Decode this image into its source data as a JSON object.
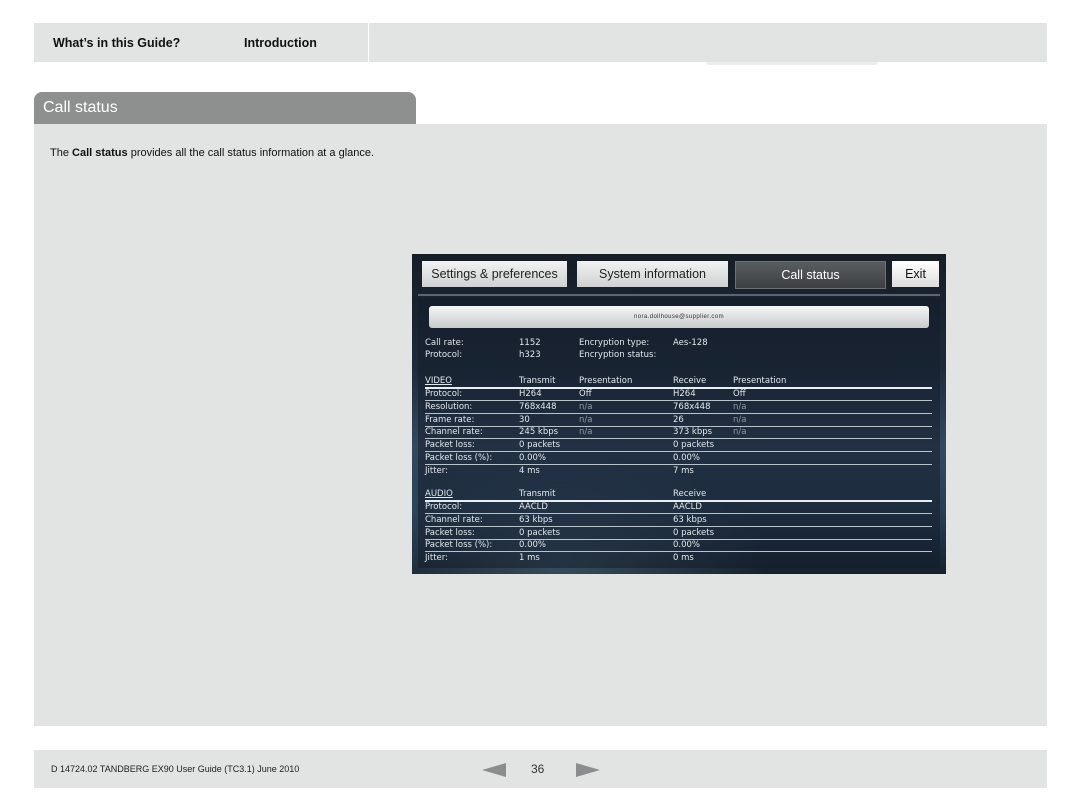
{
  "nav": {
    "tab1": "What’s in this Guide?",
    "tab2": "Introduction"
  },
  "section": {
    "title": "Call status"
  },
  "intro": {
    "prefix": "The ",
    "bold": "Call status",
    "suffix": " provides all the call status information at a glance."
  },
  "screen": {
    "tabs": {
      "settings": "Settings & preferences",
      "system": "System information",
      "call_status": "Call status",
      "exit": "Exit"
    },
    "address": "nora.dollhouse@supplier.com",
    "summary": {
      "call_rate_label": "Call rate:",
      "call_rate": "1152",
      "protocol_label": "Protocol:",
      "protocol": "h323",
      "enc_type_label": "Encryption type:",
      "enc_type": "Aes-128",
      "enc_status_label": "Encryption status:"
    },
    "video": {
      "headers": [
        "VIDEO",
        "Transmit",
        "Presentation",
        "Receive",
        "Presentation"
      ],
      "rows": [
        [
          "Protocol:",
          "H264",
          "Off",
          "H264",
          "Off"
        ],
        [
          "Resolution:",
          "768x448",
          "n/a",
          "768x448",
          "n/a"
        ],
        [
          "Frame rate:",
          "30",
          "n/a",
          "26",
          "n/a"
        ],
        [
          "Channel rate:",
          "245 kbps",
          "n/a",
          "373 kbps",
          "n/a"
        ],
        [
          "Packet loss:",
          "0 packets",
          "",
          "0 packets",
          ""
        ],
        [
          "Packet loss (%):",
          "0.00%",
          "",
          "0.00%",
          ""
        ],
        [
          "Jitter:",
          "4 ms",
          "",
          "7 ms",
          ""
        ]
      ]
    },
    "audio": {
      "headers": [
        "AUDIO",
        "Transmit",
        "",
        "Receive",
        ""
      ],
      "rows": [
        [
          "Protocol:",
          "AACLD",
          "",
          "AACLD",
          ""
        ],
        [
          "Channel rate:",
          "63 kbps",
          "",
          "63 kbps",
          ""
        ],
        [
          "Packet loss:",
          "0 packets",
          "",
          "0 packets",
          ""
        ],
        [
          "Packet loss (%):",
          "0.00%",
          "",
          "0.00%",
          ""
        ],
        [
          "Jitter:",
          "1 ms",
          "",
          "0 ms",
          ""
        ]
      ]
    }
  },
  "footer": {
    "doc": "D 14724.02 TANDBERG EX90 User Guide (TC3.1) June 2010",
    "page": "36"
  }
}
